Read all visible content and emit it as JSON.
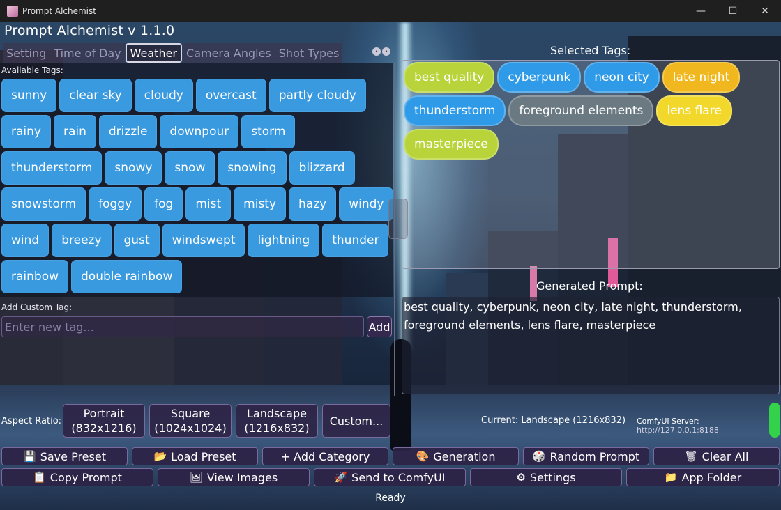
{
  "window": {
    "title": "Prompt Alchemist",
    "controls": {
      "minimize": "—",
      "maximize": "☐",
      "close": "✕"
    }
  },
  "app": {
    "title": "Prompt Alchemist v 1.1.0"
  },
  "tabs": [
    {
      "label": "Setting",
      "active": false
    },
    {
      "label": "Time of Day",
      "active": false
    },
    {
      "label": "Weather",
      "active": true
    },
    {
      "label": "Camera Angles",
      "active": false
    },
    {
      "label": "Shot Types",
      "active": false
    }
  ],
  "tab_arrows": {
    "prev": "‹",
    "next": "›"
  },
  "available": {
    "label": "Available Tags:",
    "rows": [
      [
        "sunny",
        "clear sky",
        "cloudy",
        "overcast",
        "partly cloudy"
      ],
      [
        "rainy",
        "rain",
        "drizzle",
        "downpour",
        "storm"
      ],
      [
        "thunderstorm",
        "snowy",
        "snow",
        "snowing",
        "blizzard"
      ],
      [
        "snowstorm",
        "foggy",
        "fog",
        "mist",
        "misty",
        "hazy",
        "windy"
      ],
      [
        "wind",
        "breezy",
        "gust",
        "windswept",
        "lightning",
        "thunder"
      ],
      [
        "rainbow",
        "double rainbow"
      ]
    ],
    "tag_color": "#3a9ae0"
  },
  "custom_tag": {
    "label": "Add Custom Tag:",
    "placeholder": "Enter new tag...",
    "value": "",
    "add_label": "Add"
  },
  "selected": {
    "label": "Selected Tags:",
    "rows": [
      [
        {
          "text": "best quality",
          "bg": "#b8d43a",
          "fg": "#ffffff"
        },
        {
          "text": "cyberpunk",
          "bg": "#2e9ae8",
          "fg": "#ffffff"
        },
        {
          "text": "neon city",
          "bg": "#2e9ae8",
          "fg": "#ffffff"
        },
        {
          "text": "late night",
          "bg": "#f0b81e",
          "fg": "#ffffff"
        }
      ],
      [
        {
          "text": "thunderstorm",
          "bg": "#2e9ae8",
          "fg": "#ffffff"
        },
        {
          "text": "foreground elements",
          "bg": "#6b7a82",
          "fg": "#ffffff"
        },
        {
          "text": "lens flare",
          "bg": "#f2d82a",
          "fg": "#ffffff"
        }
      ],
      [
        {
          "text": "masterpiece",
          "bg": "#b8d43a",
          "fg": "#ffffff"
        }
      ]
    ]
  },
  "generated": {
    "label": "Generated Prompt:",
    "text": "best quality, cyberpunk, neon city, late night, thunderstorm, foreground elements, lens flare, masterpiece"
  },
  "aspect": {
    "label": "Aspect Ratio:",
    "buttons": [
      {
        "line1": "Portrait",
        "line2": "(832x1216)"
      },
      {
        "line1": "Square",
        "line2": "(1024x1024)"
      },
      {
        "line1": "Landscape",
        "line2": "(1216x832)"
      },
      {
        "line1": "Custom...",
        "line2": ""
      }
    ],
    "current": "Current: Landscape (1216x832)"
  },
  "server": {
    "label": "ComfyUI Server:",
    "url": "http://127.0.0.1:8188",
    "status_color": "#34d24a"
  },
  "toolbar_row1": [
    {
      "icon": "💾",
      "label": "Save Preset"
    },
    {
      "icon": "📂",
      "label": "Load Preset"
    },
    {
      "icon": "",
      "label": "+ Add Category"
    },
    {
      "icon": "🎨",
      "label": "Generation"
    },
    {
      "icon": "🎲",
      "label": "Random Prompt"
    },
    {
      "icon": "🗑",
      "label": "Clear All"
    }
  ],
  "toolbar_row2": [
    {
      "icon": "📋",
      "label": "Copy Prompt"
    },
    {
      "icon": "🖼",
      "label": "View Images"
    },
    {
      "icon": "🚀",
      "label": "Send to ComfyUI"
    },
    {
      "icon": "⚙",
      "label": "Settings"
    },
    {
      "icon": "📁",
      "label": "App Folder"
    }
  ],
  "status": "Ready"
}
